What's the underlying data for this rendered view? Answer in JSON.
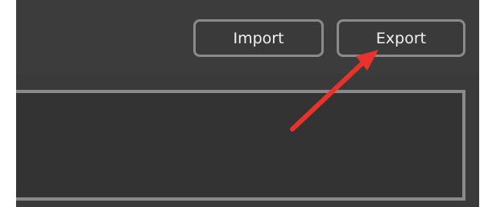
{
  "toolbar": {
    "import_label": "Import",
    "export_label": "Export"
  },
  "annotation": {
    "arrow_color": "#e8322b",
    "target": "export-button"
  },
  "colors": {
    "background": "#3a3a3a",
    "button_border": "#8a8a8a",
    "button_text": "#f2f2f2"
  }
}
